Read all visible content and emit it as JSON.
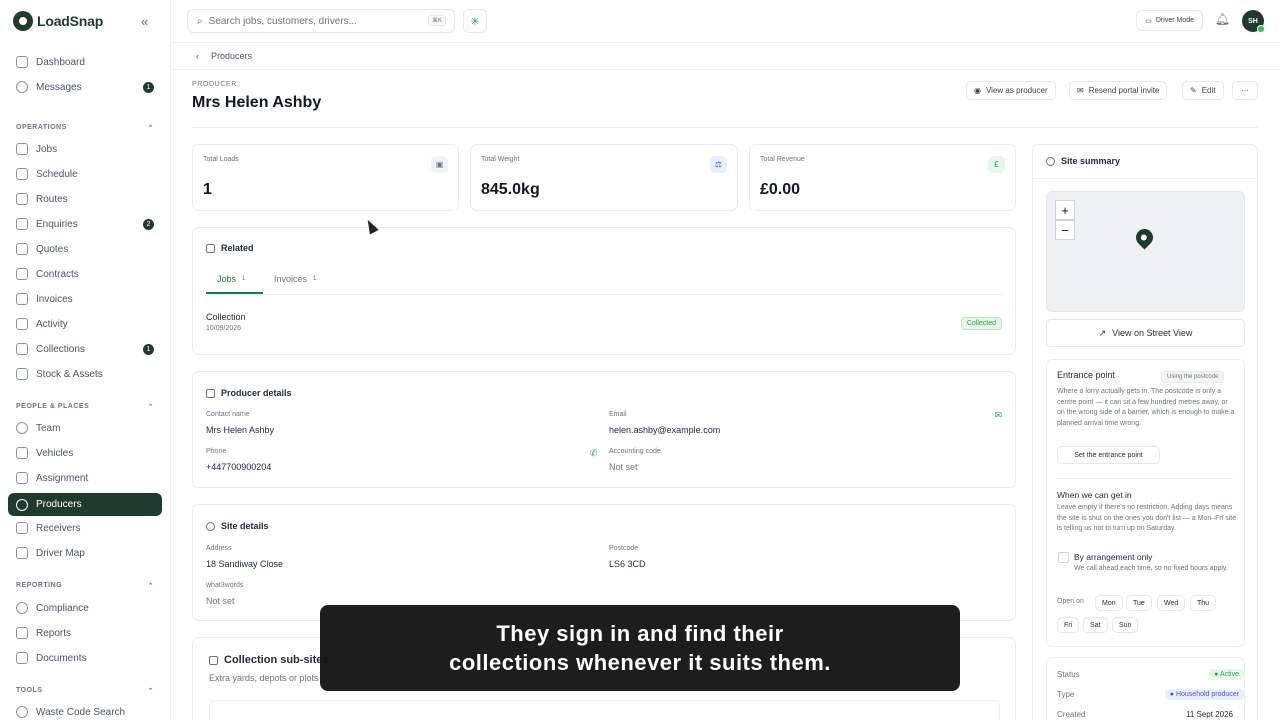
{
  "brand": {
    "name": "LoadSnap"
  },
  "search": {
    "placeholder": "Search jobs, customers, drivers...",
    "shortcut": "⌘K"
  },
  "topbar": {
    "driver_mode": "Driver Mode",
    "avatar": "SH"
  },
  "nav": {
    "top": [
      {
        "label": "Dashboard"
      },
      {
        "label": "Messages",
        "badge": "1"
      }
    ],
    "operations_title": "OPERATIONS",
    "operations": [
      {
        "label": "Jobs"
      },
      {
        "label": "Schedule"
      },
      {
        "label": "Routes"
      },
      {
        "label": "Enquiries",
        "badge": "2"
      },
      {
        "label": "Quotes"
      },
      {
        "label": "Contracts"
      },
      {
        "label": "Invoices"
      },
      {
        "label": "Activity"
      },
      {
        "label": "Collections",
        "badge": "1"
      },
      {
        "label": "Stock & Assets"
      }
    ],
    "people_title": "PEOPLE & PLACES",
    "people": [
      {
        "label": "Team"
      },
      {
        "label": "Vehicles"
      },
      {
        "label": "Assignment"
      },
      {
        "label": "Producers"
      },
      {
        "label": "Receivers"
      },
      {
        "label": "Driver Map"
      }
    ],
    "reporting_title": "REPORTING",
    "reporting": [
      {
        "label": "Compliance"
      },
      {
        "label": "Reports"
      },
      {
        "label": "Documents"
      }
    ],
    "tools_title": "TOOLS",
    "tools": [
      {
        "label": "Waste Code Search"
      }
    ]
  },
  "breadcrumb": {
    "label": "Producers"
  },
  "header": {
    "eyebrow": "PRODUCER",
    "title": "Mrs Helen Ashby",
    "view_as": "View as producer",
    "resend": "Resend portal invite",
    "edit": "Edit",
    "more": "···"
  },
  "stats": [
    {
      "label": "Total Loads",
      "value": "1",
      "color": "#6b7280",
      "bg": "#f1f2f4",
      "icon": "🚚"
    },
    {
      "label": "Total Weight",
      "value": "845.0kg",
      "color": "#3b5bdb",
      "bg": "#e9eefc",
      "icon": "⚖"
    },
    {
      "label": "Total Revenue",
      "value": "£0.00",
      "color": "#2f9e44",
      "bg": "#e6f6ea",
      "icon": "£"
    }
  ],
  "related": {
    "title": "Related",
    "tabs": [
      {
        "label": "Jobs",
        "count": "1"
      },
      {
        "label": "Invoices",
        "count": "1"
      }
    ],
    "job": {
      "title": "Collection",
      "date": "10/09/2026",
      "status": "Collected"
    }
  },
  "producer": {
    "title": "Producer details",
    "contact_label": "Contact name",
    "contact": "Mrs Helen Ashby",
    "email_label": "Email",
    "email": "helen.ashby@example.com",
    "phone_label": "Phone",
    "phone": "+447700900204",
    "acct_label": "Accounting code",
    "acct": "Not set"
  },
  "site": {
    "title": "Site details",
    "address_label": "Address",
    "address": "18 Sandiway Close",
    "postcode_label": "Postcode",
    "postcode": "LS6 3CD",
    "w3w_label": "what3words",
    "w3w": "Not set"
  },
  "subsites": {
    "title": "Collection sub-sites",
    "desc": "Extra yards, depots or plots"
  },
  "summary": {
    "title": "Site summary",
    "street_view": "View on Street View",
    "entrance_title": "Entrance point",
    "entrance_pill": "Using the postcode",
    "entrance_note": "Where a lorry actually gets in. The postcode is only a centre point — it can sit a few hundred metres away, or on the wrong side of a barrier, which is enough to make a planned arrival time wrong.",
    "set_entrance": "Set the entrance point",
    "access_title": "When we can get in",
    "access_note": "Leave empty if there's no restriction. Adding days means the site is shut on the ones you don't list — a Mon–Fri site is telling us not to turn up on Saturday.",
    "by_arrangement": "By arrangement only",
    "by_arrangement_note": "We call ahead each time, so no fixed hours apply.",
    "open_on": "Open on",
    "days": [
      "Mon",
      "Tue",
      "Wed",
      "Thu",
      "Fri",
      "Sat",
      "Sun"
    ],
    "status_label": "Status",
    "status": "Active",
    "type_label": "Type",
    "type": "Household producer",
    "created_label": "Created",
    "created": "11 Sept 2026"
  },
  "caption": {
    "line1": "They sign in and find their",
    "line2": "collections whenever it suits them."
  }
}
